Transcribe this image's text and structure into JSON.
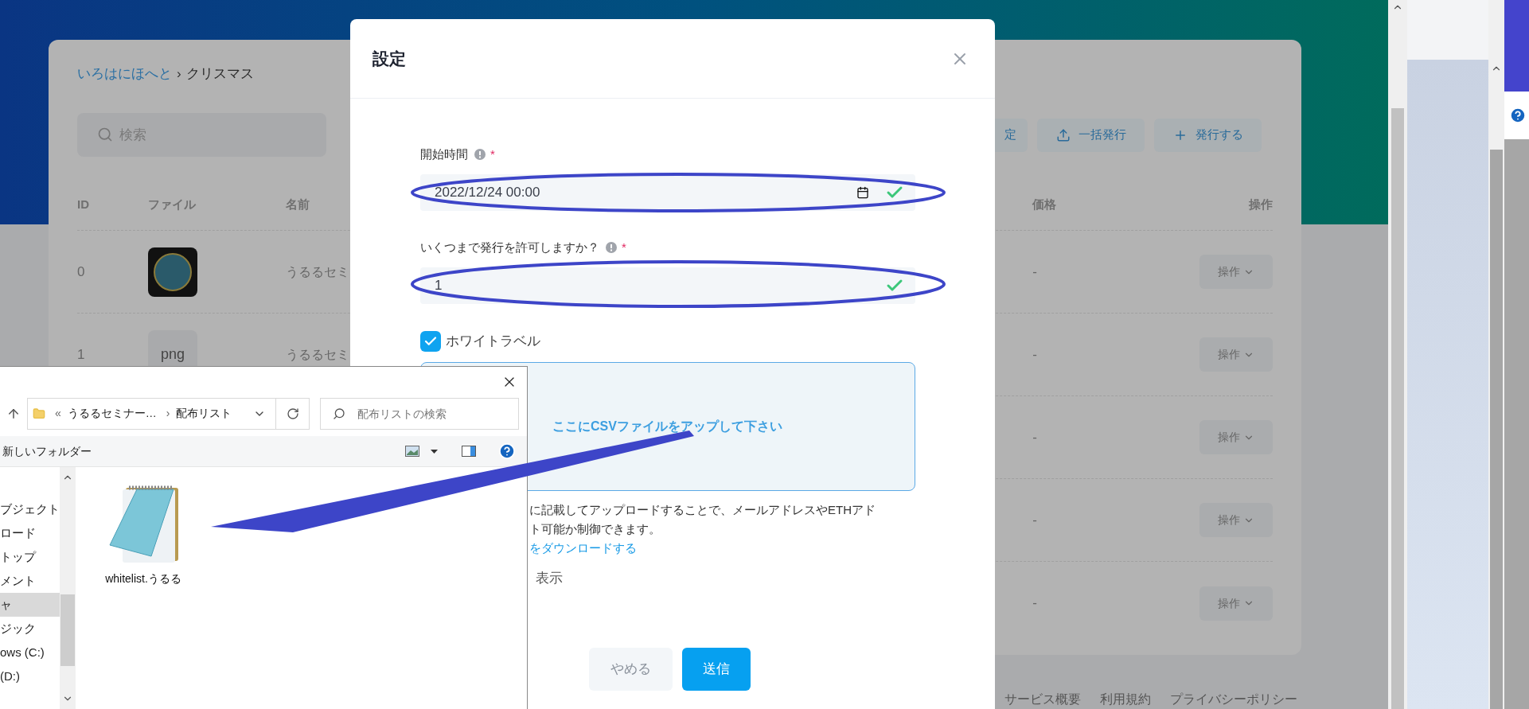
{
  "background_page": {
    "breadcrumb": [
      {
        "label": "いろはにほへと",
        "kind": "link"
      },
      {
        "label": "クリスマス",
        "kind": "current"
      }
    ],
    "breadcrumb_separator": "›",
    "search": {
      "placeholder": "検索"
    },
    "actions": [
      {
        "label": "定"
      },
      {
        "label": "一括発行"
      },
      {
        "label": "発行する"
      }
    ],
    "table": {
      "columns": [
        "ID",
        "ファイル",
        "名前",
        "価格",
        "操作"
      ],
      "rows": [
        {
          "id": "0",
          "file": {
            "kind": "image"
          },
          "name": "うるるセミ",
          "price": "-",
          "action": "操作"
        },
        {
          "id": "1",
          "file": {
            "kind": "text",
            "label": "png"
          },
          "name": "うるるセミ",
          "price": "-",
          "action": "操作"
        },
        {
          "price": "-",
          "action": "操作"
        },
        {
          "price": "-",
          "action": "操作"
        },
        {
          "price": "-",
          "action": "操作"
        }
      ]
    },
    "footer_links": [
      "サービス概要",
      "利用規約",
      "プライバシーポリシー"
    ]
  },
  "modal": {
    "title": "設定",
    "fields": [
      {
        "label": "開始時間",
        "required_mark": "*",
        "value": "2022/12/24 00:00",
        "kind": "datetime",
        "valid": true
      },
      {
        "label": "いくつまで発行を許可しますか？",
        "required_mark": "*",
        "value": "1",
        "kind": "number",
        "valid": true
      }
    ],
    "whitelabel": {
      "label": "ホワイトラベル",
      "checked": true
    },
    "dropzone": {
      "text": "ここにCSVファイルをアップして下さい"
    },
    "description_lines": [
      "に記載してアップロードすることで、メールアドレスやETHアド",
      "ト可能か制御できます。"
    ],
    "download_link": "をダウンロードする",
    "toggle_text": "表示",
    "buttons": [
      {
        "label": "やめる",
        "kind": "secondary"
      },
      {
        "label": "送信",
        "kind": "primary"
      }
    ]
  },
  "file_dialog": {
    "path": {
      "prefix": "«",
      "segments": [
        "うるるセミナー…",
        "配布リスト"
      ],
      "separator": "›"
    },
    "search": {
      "placeholder": "配布リストの検索"
    },
    "new_folder": "新しいフォルダー",
    "nav_items": [
      {
        "label": "ブジェクト",
        "selected": false
      },
      {
        "label": "ロード",
        "selected": false
      },
      {
        "label": "トップ",
        "selected": false
      },
      {
        "label": "メント",
        "selected": false
      },
      {
        "label": "ャ",
        "selected": true
      },
      {
        "label": "ジック",
        "selected": false
      },
      {
        "label": "ows (C:)",
        "selected": false
      },
      {
        "label": "(D:)",
        "selected": false
      }
    ],
    "files": [
      {
        "name": "whitelist.うるる",
        "kind": "notepad"
      }
    ]
  }
}
